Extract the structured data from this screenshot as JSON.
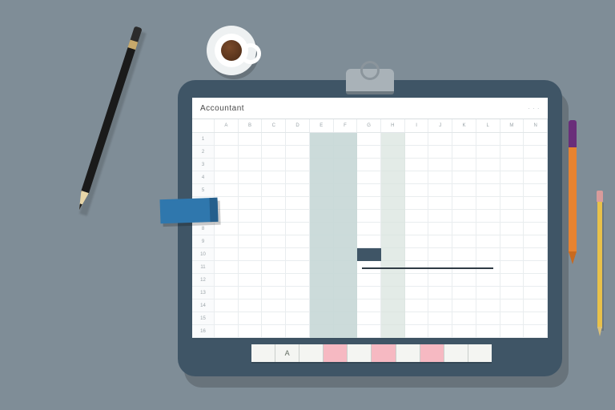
{
  "sheet": {
    "title": "Accountant",
    "header_right": "·  ·  ·",
    "columns": [
      "",
      "A",
      "B",
      "C",
      "D",
      "E",
      "F",
      "G",
      "H",
      "I",
      "J",
      "K",
      "L",
      "M",
      "N"
    ],
    "row_count": 16
  },
  "ruler": {
    "segments": [
      "",
      "A",
      "",
      "",
      "",
      "",
      "",
      "",
      "",
      ""
    ],
    "pink_indices": [
      3,
      5,
      7
    ]
  }
}
